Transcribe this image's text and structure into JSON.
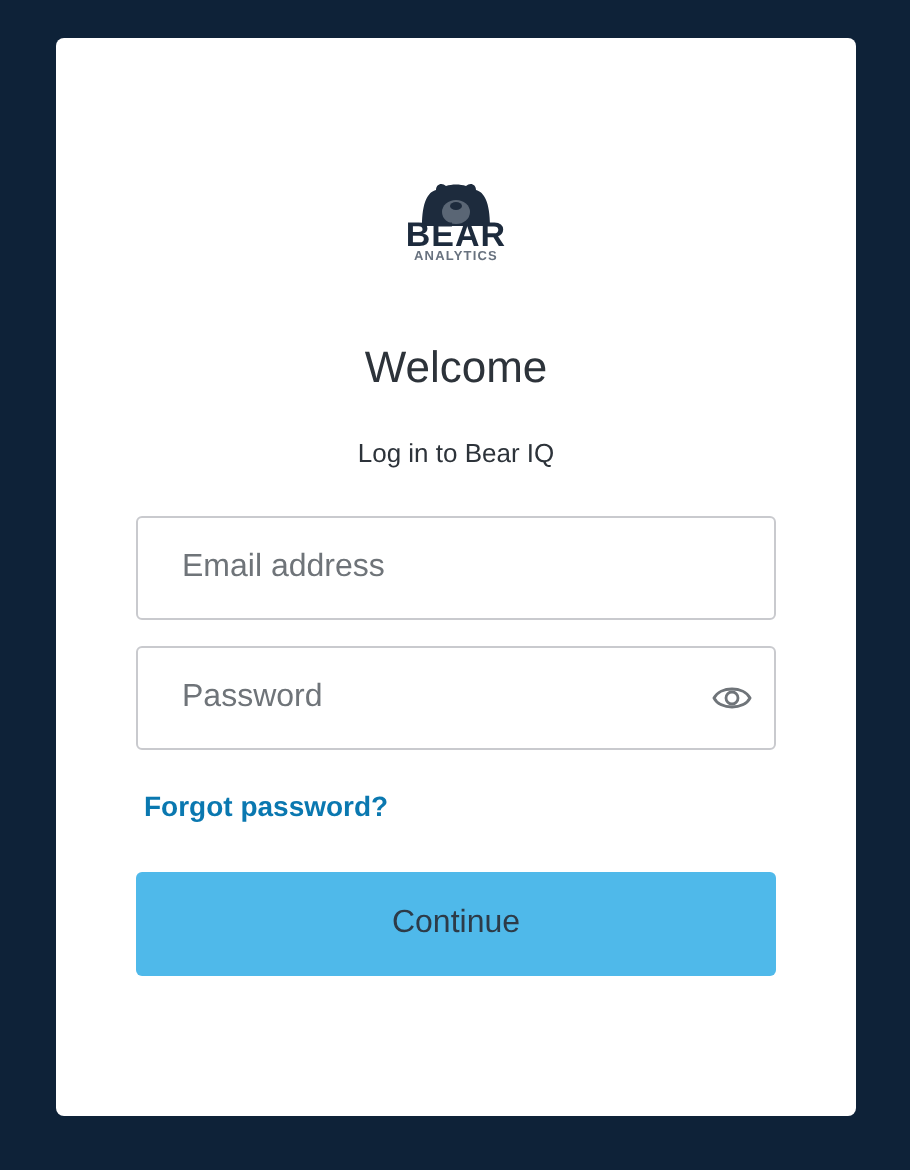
{
  "logo": {
    "name": "BEAR",
    "tagline": "ANALYTICS"
  },
  "title": "Welcome",
  "subtitle": "Log in to Bear IQ",
  "fields": [
    {
      "kind": "email",
      "placeholder": "Email address"
    },
    {
      "kind": "password",
      "placeholder": "Password"
    }
  ],
  "forgot_link": "Forgot password?",
  "submit_button": "Continue"
}
